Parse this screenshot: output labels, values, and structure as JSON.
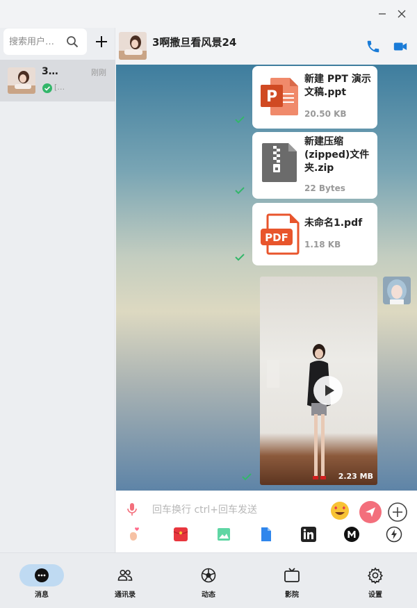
{
  "window": {
    "controls": [
      "minimize-icon",
      "close-icon"
    ]
  },
  "sidebar": {
    "search": {
      "placeholder": "搜索用户…"
    },
    "conversations": [
      {
        "name": "3…",
        "time": "刚刚",
        "preview": "[…",
        "status": "delivered"
      }
    ]
  },
  "chat": {
    "title": "3啊撒旦看风景24",
    "messages": [
      {
        "type": "file",
        "kind": "ppt",
        "icon": "ppt-file-icon",
        "name": "新建 PPT 演示文稿.ppt",
        "size": "20.50 KB",
        "status": "delivered"
      },
      {
        "type": "file",
        "kind": "zip",
        "icon": "zip-file-icon",
        "name": "新建压缩(zipped)文件夹.zip",
        "size": "22 Bytes",
        "status": "delivered"
      },
      {
        "type": "file",
        "kind": "pdf",
        "icon": "pdf-file-icon",
        "name": "未命名1.pdf",
        "size": "1.18 KB",
        "status": "delivered"
      },
      {
        "type": "video",
        "size": "2.23 MB",
        "status": "delivered"
      }
    ],
    "composer": {
      "placeholder": "回车换行 ctrl+回车发送",
      "tools": [
        "hand-heart-icon",
        "red-envelope-icon",
        "image-icon",
        "file-icon",
        "linkedin-icon",
        "m-icon",
        "lightning-icon"
      ]
    }
  },
  "nav": {
    "items": [
      {
        "label": "消息",
        "icon": "chat-bubble-icon",
        "active": true
      },
      {
        "label": "通讯录",
        "icon": "contacts-icon",
        "active": false
      },
      {
        "label": "动态",
        "icon": "moments-icon",
        "active": false
      },
      {
        "label": "影院",
        "icon": "tv-icon",
        "active": false
      },
      {
        "label": "设置",
        "icon": "gear-icon",
        "active": false
      }
    ]
  },
  "colors": {
    "accent": "#1a7bd7",
    "check": "#33b66a",
    "send": "#f36f7c",
    "nav_active": "#bfdaf2",
    "ppt": "#d04a23",
    "pdf": "#e8552c",
    "zip": "#6b6b6b"
  }
}
